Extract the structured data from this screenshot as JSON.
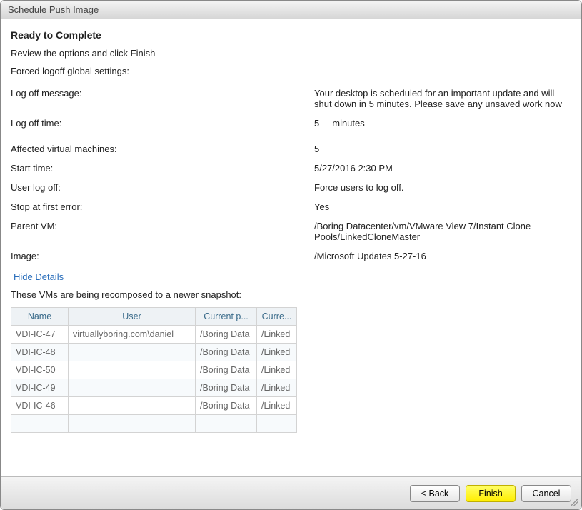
{
  "window": {
    "title": "Schedule Push Image"
  },
  "heading": "Ready to Complete",
  "subheading": "Review the options and click Finish",
  "sectionLabel": "Forced logoff global settings:",
  "rows": {
    "logoffMessage": {
      "label": "Log off message:",
      "value": "Your desktop is scheduled for an important update and will shut down in 5 minutes. Please save any unsaved work now"
    },
    "logoffTime": {
      "label": "Log off time:",
      "value": "5",
      "unit": "minutes"
    },
    "affected": {
      "label": "Affected virtual machines:",
      "value": "5"
    },
    "startTime": {
      "label": "Start time:",
      "value": "5/27/2016 2:30 PM"
    },
    "userLogoff": {
      "label": "User log off:",
      "value": "Force users to log off."
    },
    "stopAtFirst": {
      "label": "Stop at first error:",
      "value": "Yes"
    },
    "parentVM": {
      "label": "Parent VM:",
      "value": "/Boring Datacenter/vm/VMware View 7/Instant Clone Pools/LinkedCloneMaster"
    },
    "image": {
      "label": "Image:",
      "value": "/Microsoft Updates 5-27-16"
    }
  },
  "detailsLink": "Hide Details",
  "tableCaption": "These VMs are being recomposed to a newer snapshot:",
  "table": {
    "headers": {
      "name": "Name",
      "user": "User",
      "currentParent": "Current p...",
      "currentImage": "Curre..."
    },
    "rows": [
      {
        "name": "VDI-IC-47",
        "user": "virtuallyboring.com\\daniel",
        "currentParent": "/Boring Data",
        "currentImage": "/Linked"
      },
      {
        "name": "VDI-IC-48",
        "user": "",
        "currentParent": "/Boring Data",
        "currentImage": "/Linked"
      },
      {
        "name": "VDI-IC-50",
        "user": "",
        "currentParent": "/Boring Data",
        "currentImage": "/Linked"
      },
      {
        "name": "VDI-IC-49",
        "user": "",
        "currentParent": "/Boring Data",
        "currentImage": "/Linked"
      },
      {
        "name": "VDI-IC-46",
        "user": "",
        "currentParent": "/Boring Data",
        "currentImage": "/Linked"
      }
    ]
  },
  "buttons": {
    "back": "< Back",
    "finish": "Finish",
    "cancel": "Cancel"
  }
}
